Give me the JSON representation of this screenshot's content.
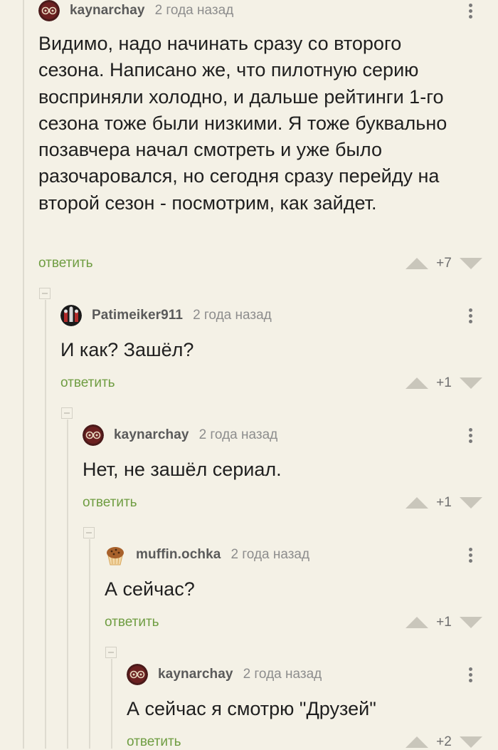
{
  "reply_label": "ответить",
  "comments": [
    {
      "username": "kaynarchay",
      "time": "2 года назад",
      "avatar": "kaynarchay-avatar",
      "text": "Видимо, надо начинать сразу со второго сезона. Написано же, что пилотную серию восприняли холодно, и дальше рейтинги 1-го сезона тоже были низкими. Я тоже буквально позавчера начал смотреть и уже было разочаровался, но сегодня сразу перейду на второй сезон - посмотрим, как зайдет.",
      "score": "+7"
    },
    {
      "username": "Patimeiker911",
      "time": "2 года назад",
      "avatar": "patimeiker-avatar",
      "text": "И как? Зашёл?",
      "score": "+1"
    },
    {
      "username": "kaynarchay",
      "time": "2 года назад",
      "avatar": "kaynarchay-avatar",
      "text": "Нет, не зашёл сериал.",
      "score": "+1"
    },
    {
      "username": "muffin.ochka",
      "time": "2 года назад",
      "avatar": "muffin-avatar",
      "text": "А сейчас?",
      "score": "+1"
    },
    {
      "username": "kaynarchay",
      "time": "2 года назад",
      "avatar": "kaynarchay-avatar",
      "text": "А сейчас я смотрю \"Друзей\"",
      "score": "+2"
    }
  ],
  "colors": {
    "background": "#f4f1e6",
    "reply_link": "#6f9d42",
    "vote_arrow": "#c9c6bb",
    "username": "#5a5a5a",
    "muted": "#8d8d8d"
  }
}
